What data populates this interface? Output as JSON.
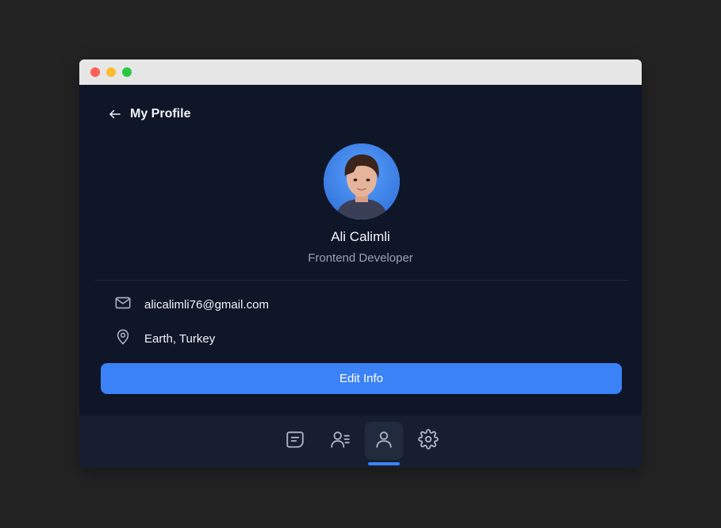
{
  "header": {
    "back_icon": "arrow-left-icon",
    "title": "My Profile"
  },
  "profile": {
    "name": "Ali Calimli",
    "role": "Frontend Developer",
    "avatar_bg": "#3b82f6"
  },
  "info": {
    "email": {
      "icon": "mail-icon",
      "value": "alicalimli76@gmail.com"
    },
    "location": {
      "icon": "map-pin-icon",
      "value": "Earth, Turkey"
    }
  },
  "actions": {
    "edit_label": "Edit Info"
  },
  "nav": {
    "items": [
      {
        "icon": "chat-icon",
        "active": false
      },
      {
        "icon": "contacts-icon",
        "active": false
      },
      {
        "icon": "profile-icon",
        "active": true
      },
      {
        "icon": "settings-icon",
        "active": false
      }
    ],
    "accent": "#3b82f6"
  }
}
